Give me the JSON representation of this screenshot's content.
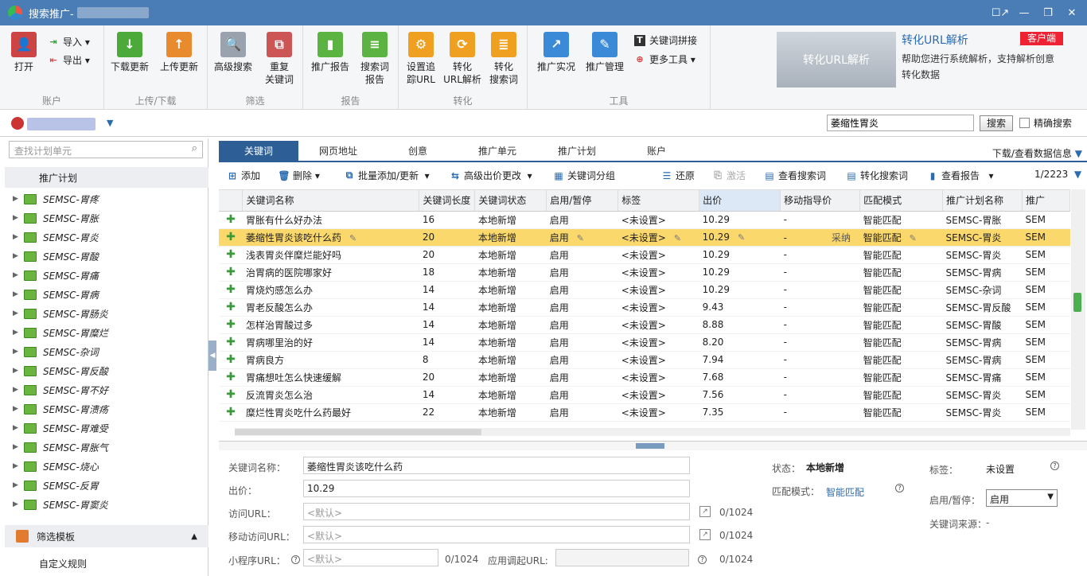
{
  "app": {
    "title": "搜索推广-"
  },
  "window": {
    "controls": [
      "☐↗",
      "—",
      "❐",
      "✕"
    ]
  },
  "ribbon": {
    "groups": [
      {
        "label": "账户"
      },
      {
        "label": "上传/下载"
      },
      {
        "label": "筛选"
      },
      {
        "label": "报告"
      },
      {
        "label": "转化"
      },
      {
        "label": "工具"
      }
    ],
    "open": "打开",
    "import": "导入",
    "export": "导出",
    "download_update": "下载更新",
    "upload_update": "上传更新",
    "advanced_search": "高级搜索",
    "duplicate_kw_1": "重复",
    "duplicate_kw_2": "关键词",
    "promo_report": "推广报告",
    "searchterm_report_1": "搜索词",
    "searchterm_report_2": "报告",
    "set_tracking_1": "设置追",
    "set_tracking_2": "踪URL",
    "conv_url_1": "转化",
    "conv_url_2": "URL解析",
    "conv_search_1": "转化",
    "conv_search_2": "搜索词",
    "promo_live": "推广实况",
    "promo_manage": "推广管理",
    "kw_combine": "关键词拼接",
    "more_tools": "更多工具",
    "banner_image_text": "转化URL解析",
    "banner_title": "转化URL解析",
    "banner_desc": "帮助您进行系统解析，支持解析创意转化数据",
    "client_badge": "客户端"
  },
  "search": {
    "value": "萎缩性胃炎",
    "button": "搜索",
    "exact": "精确搜索"
  },
  "sidebar": {
    "search_placeholder": "查找计划单元",
    "header": "推广计划",
    "plans": [
      "SEMSC-胃疼",
      "SEMSC-胃胀",
      "SEMSC-胃炎",
      "SEMSC-胃酸",
      "SEMSC-胃痛",
      "SEMSC-胃病",
      "SEMSC-胃肠炎",
      "SEMSC-胃糜烂",
      "SEMSC-杂词",
      "SEMSC-胃反酸",
      "SEMSC-胃不好",
      "SEMSC-胃溃疡",
      "SEMSC-胃难受",
      "SEMSC-胃胀气",
      "SEMSC-烧心",
      "SEMSC-反胃",
      "SEMSC-胃窦炎"
    ],
    "filter_template": "筛选模板",
    "custom_rule": "自定义规则"
  },
  "tabs": [
    "关键词",
    "网页地址",
    "创意",
    "推广单元",
    "推广计划",
    "账户"
  ],
  "download_info": "下载/查看数据信息",
  "toolbar": {
    "add": "添加",
    "delete": "删除",
    "bulk_add": "批量添加/更新",
    "adv_bid": "高级出价更改",
    "kw_group": "关键词分组",
    "restore": "还原",
    "activate": "激活",
    "view_searchterm": "查看搜索词",
    "conv_searchterm": "转化搜索词",
    "view_report": "查看报告",
    "page": "1/2223"
  },
  "grid": {
    "columns": [
      "",
      "关键词名称",
      "关键词长度",
      "关键词状态",
      "启用/暂停",
      "标签",
      "出价",
      "移动指导价",
      "匹配模式",
      "推广计划名称",
      "推广"
    ],
    "rows": [
      [
        "胃胀有什么好办法",
        "16",
        "本地新增",
        "启用",
        "<未设置>",
        "10.29",
        "-",
        "智能匹配",
        "SEMSC-胃胀",
        "SEM"
      ],
      [
        "萎缩性胃炎该吃什么药",
        "20",
        "本地新增",
        "启用",
        "<未设置>",
        "10.29",
        "-",
        "智能匹配",
        "SEMSC-胃炎",
        "SEM"
      ],
      [
        "浅表胃炎伴糜烂能好吗",
        "20",
        "本地新增",
        "启用",
        "<未设置>",
        "10.29",
        "-",
        "智能匹配",
        "SEMSC-胃炎",
        "SEM"
      ],
      [
        "治胃病的医院哪家好",
        "18",
        "本地新增",
        "启用",
        "<未设置>",
        "10.29",
        "-",
        "智能匹配",
        "SEMSC-胃病",
        "SEM"
      ],
      [
        "胃烧灼感怎么办",
        "14",
        "本地新增",
        "启用",
        "<未设置>",
        "10.29",
        "-",
        "智能匹配",
        "SEMSC-杂词",
        "SEM"
      ],
      [
        "胃老反酸怎么办",
        "14",
        "本地新增",
        "启用",
        "<未设置>",
        "9.43",
        "-",
        "智能匹配",
        "SEMSC-胃反酸",
        "SEM"
      ],
      [
        "怎样治胃酸过多",
        "14",
        "本地新增",
        "启用",
        "<未设置>",
        "8.88",
        "-",
        "智能匹配",
        "SEMSC-胃酸",
        "SEM"
      ],
      [
        "胃病哪里治的好",
        "14",
        "本地新增",
        "启用",
        "<未设置>",
        "8.20",
        "-",
        "智能匹配",
        "SEMSC-胃病",
        "SEM"
      ],
      [
        "胃病良方",
        "8",
        "本地新增",
        "启用",
        "<未设置>",
        "7.94",
        "-",
        "智能匹配",
        "SEMSC-胃病",
        "SEM"
      ],
      [
        "胃痛想吐怎么快速缓解",
        "20",
        "本地新增",
        "启用",
        "<未设置>",
        "7.68",
        "-",
        "智能匹配",
        "SEMSC-胃痛",
        "SEM"
      ],
      [
        "反流胃炎怎么治",
        "14",
        "本地新增",
        "启用",
        "<未设置>",
        "7.56",
        "-",
        "智能匹配",
        "SEMSC-胃炎",
        "SEM"
      ],
      [
        "糜烂性胃炎吃什么药最好",
        "22",
        "本地新增",
        "启用",
        "<未设置>",
        "7.35",
        "-",
        "智能匹配",
        "SEMSC-胃炎",
        "SEM"
      ]
    ],
    "selected_row": 1,
    "selected_extra": "采纳"
  },
  "detail": {
    "kw_name_label": "关键词名称：",
    "kw_name": "萎缩性胃炎该吃什么药",
    "bid_label": "出价：",
    "bid": "10.29",
    "url_label": "访问URL：",
    "url_ph": "<默认>",
    "url_count": "0/1024",
    "murl_label": "移动访问URL：",
    "murl_ph": "<默认>",
    "murl_count": "0/1024",
    "mini_label": "小程序URL：",
    "mini_ph": "<默认>",
    "mini_count": "0/1024",
    "app_label": "应用调起URL:",
    "app_count": "0/1024",
    "status_label": "状态：",
    "status": "本地新增",
    "match_label": "匹配模式：",
    "match": "智能匹配",
    "tag_label": "标签：",
    "tag": "未设置",
    "enable_label": "启用/暂停：",
    "enable": "启用",
    "source_label": "关键词来源：",
    "source": "-"
  }
}
